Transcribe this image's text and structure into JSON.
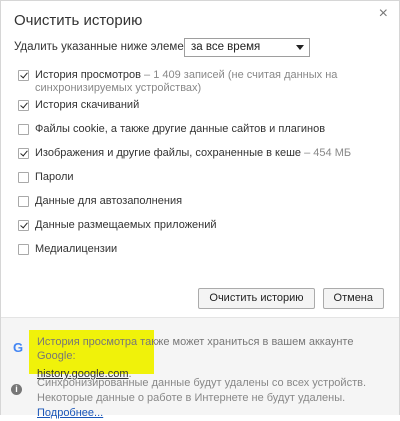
{
  "dialog": {
    "title": "Очистить историю",
    "close_glyph": "×"
  },
  "range": {
    "label": "Удалить указанные ниже элементы",
    "selected": "за все время"
  },
  "options": [
    {
      "label": "История просмотров",
      "detail": " – 1 409 записей (не считая данных на синхронизируемых устройствах)",
      "checked": true
    },
    {
      "label": "История скачиваний",
      "detail": "",
      "checked": true
    },
    {
      "label": "Файлы cookie, а также другие данные сайтов и плагинов",
      "detail": "",
      "checked": false
    },
    {
      "label": "Изображения и другие файлы, сохраненные в кеше",
      "detail": " – 454 МБ",
      "checked": true
    },
    {
      "label": "Пароли",
      "detail": "",
      "checked": false
    },
    {
      "label": "Данные для автозаполнения",
      "detail": "",
      "checked": false
    },
    {
      "label": "Данные размещаемых приложений",
      "detail": "",
      "checked": true
    },
    {
      "label": "Медиалицензии",
      "detail": "",
      "checked": false
    }
  ],
  "buttons": {
    "clear": "Очистить историю",
    "cancel": "Отмена"
  },
  "footer": {
    "google_text": "История просмотра также может храниться в вашем аккаунте Google:",
    "google_link": "history.google.com",
    "google_link_suffix": ".",
    "sync_text": "Синхронизированные данные будут удалены со всех устройств. Некоторые данные о работе в Интернете не будут удалены. ",
    "more_link": "Подробнее..."
  },
  "colors": {
    "highlight": "#f0f20a",
    "link": "#1a56b8",
    "google_blue": "#4285f4"
  },
  "icons": {
    "google": "google-logo-icon",
    "info": "info-icon",
    "close": "close-icon"
  }
}
